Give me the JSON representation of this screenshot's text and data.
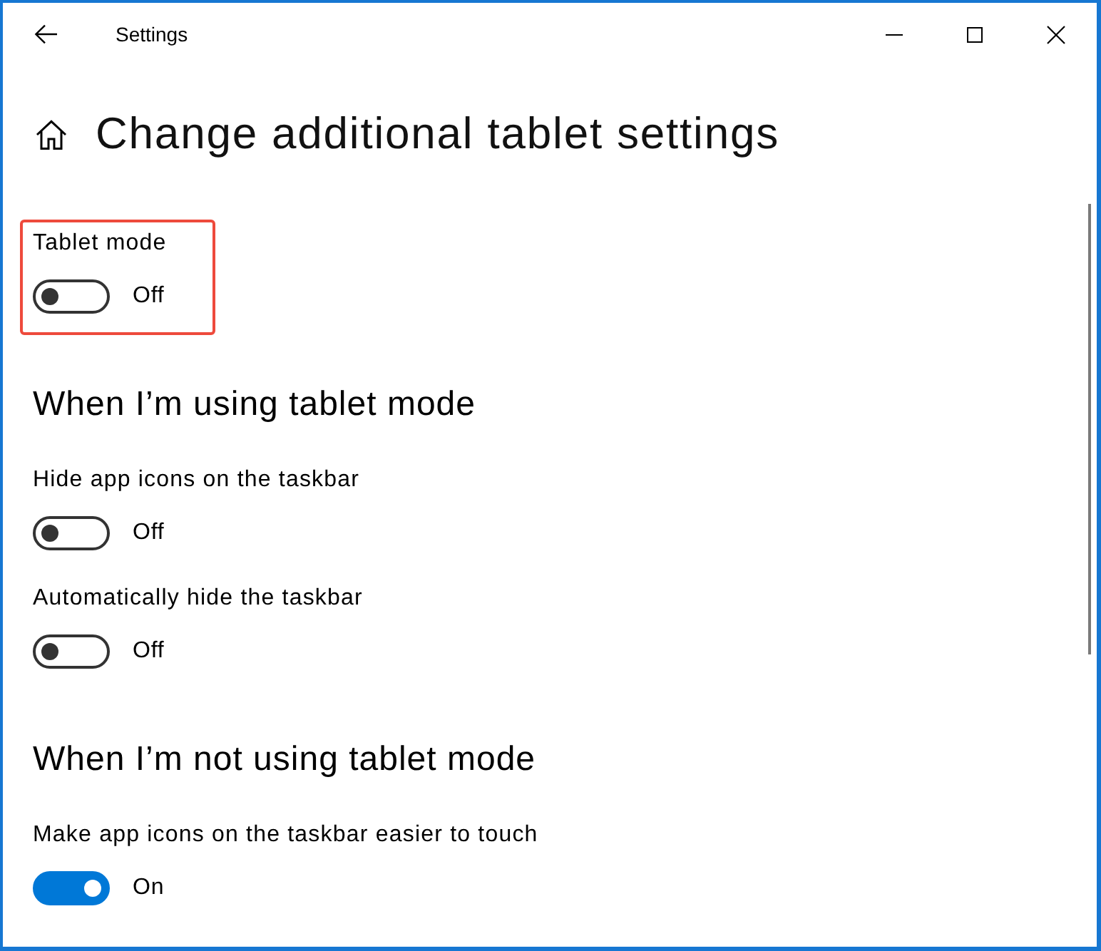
{
  "window": {
    "title": "Settings"
  },
  "page": {
    "title": "Change additional tablet settings"
  },
  "sections": [
    {
      "toggles": [
        {
          "label": "Tablet mode",
          "on": false,
          "state_text": "Off",
          "highlighted": true
        }
      ]
    },
    {
      "heading": "When I’m using tablet mode",
      "toggles": [
        {
          "label": "Hide app icons on the taskbar",
          "on": false,
          "state_text": "Off",
          "highlighted": false
        },
        {
          "label": "Automatically hide the taskbar",
          "on": false,
          "state_text": "Off",
          "highlighted": false
        }
      ]
    },
    {
      "heading": "When I’m not using tablet mode",
      "toggles": [
        {
          "label": "Make app icons on the taskbar easier to touch",
          "on": true,
          "state_text": "On",
          "highlighted": false
        }
      ]
    }
  ]
}
